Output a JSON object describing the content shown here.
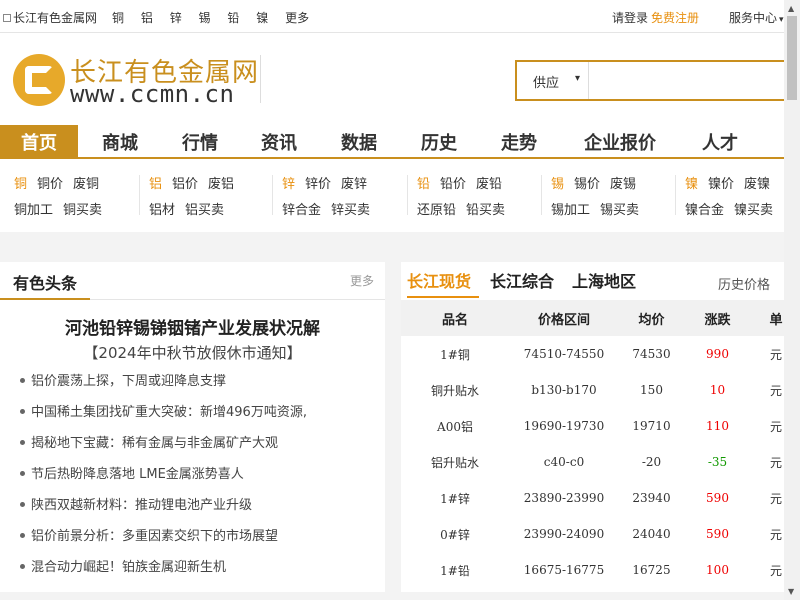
{
  "topbar": {
    "home": "长江有色金属网",
    "links": [
      "铜",
      "铝",
      "锌",
      "锡",
      "铅",
      "镍",
      "更多"
    ],
    "login": "请登录",
    "register": "免费注册",
    "service": "服务中心"
  },
  "logo": {
    "cn": "长江有色金属网",
    "en": "www.ccmn.cn"
  },
  "search": {
    "select": "供应",
    "placeholder": ""
  },
  "nav": [
    "首页",
    "商城",
    "行情",
    "资讯",
    "数据",
    "历史",
    "走势",
    "企业报价",
    "人才"
  ],
  "metals": [
    {
      "name": "铜",
      "row1": [
        "铜价",
        "废铜"
      ],
      "row2": [
        "铜加工",
        "铜买卖"
      ]
    },
    {
      "name": "铝",
      "row1": [
        "铝价",
        "废铝"
      ],
      "row2": [
        "铝材",
        "铝买卖"
      ]
    },
    {
      "name": "锌",
      "row1": [
        "锌价",
        "废锌"
      ],
      "row2": [
        "锌合金",
        "锌买卖"
      ]
    },
    {
      "name": "铅",
      "row1": [
        "铅价",
        "废铅"
      ],
      "row2": [
        "还原铅",
        "铅买卖"
      ]
    },
    {
      "name": "锡",
      "row1": [
        "锡价",
        "废锡"
      ],
      "row2": [
        "锡加工",
        "锡买卖"
      ]
    },
    {
      "name": "镍",
      "row1": [
        "镍价",
        "废镍"
      ],
      "row2": [
        "镍合金",
        "镍买卖"
      ]
    }
  ],
  "news_panel": {
    "title": "有色头条",
    "more": "更多",
    "headline": "河池铅锌锡锑铟锗产业发展状况解",
    "subheadline": "【2024年中秋节放假休市通知】",
    "items": [
      "铝价震荡上探，下周或迎降息支撑",
      "中国稀土集团找矿重大突破：新增496万吨资源,",
      "揭秘地下宝藏：稀有金属与非金属矿产大观",
      "节后热盼降息落地 LME金属涨势喜人",
      "陕西双越新材料：推动锂电池产业升级",
      "铝价前景分析：多重因素交织下的市场展望",
      "混合动力崛起！铂族金属迎新生机"
    ]
  },
  "price_panel": {
    "tabs": [
      "长江现货",
      "长江综合",
      "上海地区"
    ],
    "history": "历史价格",
    "columns": [
      "品名",
      "价格区间",
      "均价",
      "涨跌",
      "单"
    ],
    "rows": [
      {
        "name": "1#铜",
        "range": "74510-74550",
        "avg": "74530",
        "change": "990",
        "trend": "up",
        "unit": "元"
      },
      {
        "name": "铜升贴水",
        "range": "b130-b170",
        "avg": "150",
        "change": "10",
        "trend": "up",
        "unit": "元"
      },
      {
        "name": "A00铝",
        "range": "19690-19730",
        "avg": "19710",
        "change": "110",
        "trend": "up",
        "unit": "元"
      },
      {
        "name": "铝升贴水",
        "range": "c40-c0",
        "avg": "-20",
        "change": "-35",
        "trend": "down",
        "unit": "元"
      },
      {
        "name": "1#锌",
        "range": "23890-23990",
        "avg": "23940",
        "change": "590",
        "trend": "up",
        "unit": "元"
      },
      {
        "name": "0#锌",
        "range": "23990-24090",
        "avg": "24040",
        "change": "590",
        "trend": "up",
        "unit": "元"
      },
      {
        "name": "1#铅",
        "range": "16675-16775",
        "avg": "16725",
        "change": "100",
        "trend": "up",
        "unit": "元"
      }
    ]
  },
  "colors": {
    "brand": "#c98f1e",
    "accent": "#e8900f",
    "up": "#e00000",
    "down": "#119900"
  }
}
